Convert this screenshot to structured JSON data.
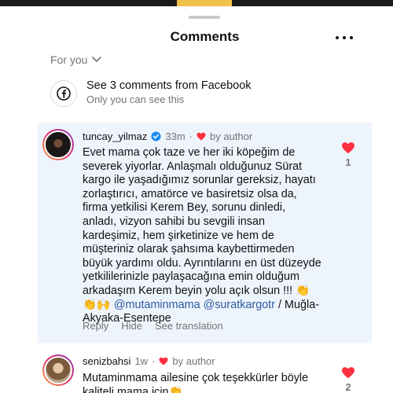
{
  "header": {
    "title": "Comments",
    "more_icon": "more-horizontal-icon"
  },
  "sort": {
    "label": "For you",
    "icon": "chevron-down-icon"
  },
  "facebook_row": {
    "icon": "facebook-icon",
    "title": "See 3 comments from Facebook",
    "subtitle": "Only you can see this"
  },
  "comments": [
    {
      "username": "tuncay_yilmaz",
      "verified": true,
      "time": "33m",
      "by_author": "by author",
      "lines": [
        "Evet mama çok taze ve her iki köpeğim de",
        "severek yiyorlar. Anlaşmalı olduğunuz Sürat",
        "kargo ile yaşadığımız sorunlar gereksiz, hayatı",
        "zorlaştırıcı, amatörce ve basiretsiz olsa da,",
        "firma yetkilisi Kerem Bey, sorunu dinledi,",
        "anladı, vizyon sahibi bu sevgili insan",
        "kardeşimiz, hem şirketinize ve hem de",
        "müşteriniz olarak şahsıma kaybettirmeden",
        "büyük yardımı oldu. Ayrıntılarını en üst düzeyde",
        "yetkililerinizle paylaşacağına emin olduğum",
        "arkadaşım Kerem beyin yolu açık olsun !!! 👏"
      ],
      "line12_emoji": "👏🙌",
      "mention1": "@mutaminmama",
      "mention2": "@suratkargotr",
      "line12_tail": " / Muğla-",
      "line13": "Akyaka-Esentepe",
      "reply": "Reply",
      "hide": "Hide",
      "see_translation": "See translation",
      "likes": "1",
      "liked": true
    },
    {
      "username": "senizbahsi",
      "verified": false,
      "time": "1w",
      "by_author": "by author",
      "lines": [
        "Mutaminmama ailesine çok teşekkürler böyle",
        "kaliteli mama için👏"
      ],
      "likes": "2",
      "liked": true
    }
  ],
  "colors": {
    "heart": "#ff3040",
    "highlight": "#eef4fc",
    "mention": "#2a5a9e",
    "verified": "#1d8cf0"
  }
}
